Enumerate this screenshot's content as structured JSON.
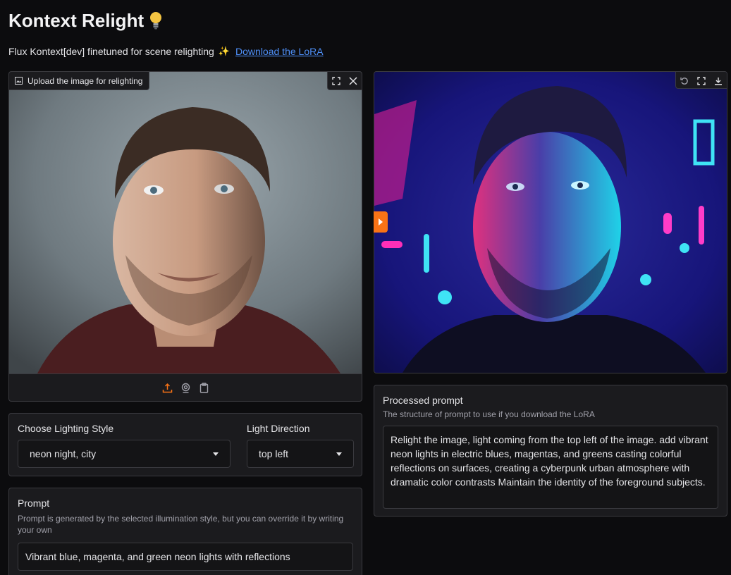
{
  "header": {
    "title": "Kontext Relight",
    "subtitle": "Flux Kontext[dev] finetuned for scene relighting",
    "link_label": "Download the LoRA"
  },
  "input_image": {
    "label": "Upload the image for relighting",
    "tools": [
      "fullscreen-icon",
      "close-icon"
    ],
    "sources": [
      "upload-icon",
      "webcam-icon",
      "clipboard-icon"
    ]
  },
  "output_image": {
    "tools": [
      "undo-icon",
      "fullscreen-icon",
      "download-icon"
    ]
  },
  "lighting": {
    "style_label": "Choose Lighting Style",
    "style_value": "neon night, city",
    "direction_label": "Light Direction",
    "direction_value": "top left"
  },
  "prompt": {
    "label": "Prompt",
    "info": "Prompt is generated by the selected illumination style, but you can override it by writing your own",
    "value": "Vibrant blue, magenta, and green neon lights with reflections"
  },
  "processed_prompt": {
    "label": "Processed prompt",
    "info": "The structure of prompt to use if you download the LoRA",
    "value": "Relight the image, light coming from the top left of the image. add vibrant neon lights in electric blues, magentas, and greens casting colorful reflections on surfaces, creating a cyberpunk urban atmosphere with dramatic color contrasts Maintain the identity of the foreground subjects."
  },
  "colors": {
    "accent": "#f97316",
    "link": "#4e8ff7",
    "background": "#0c0c0e",
    "panel": "#1b1b1e"
  }
}
